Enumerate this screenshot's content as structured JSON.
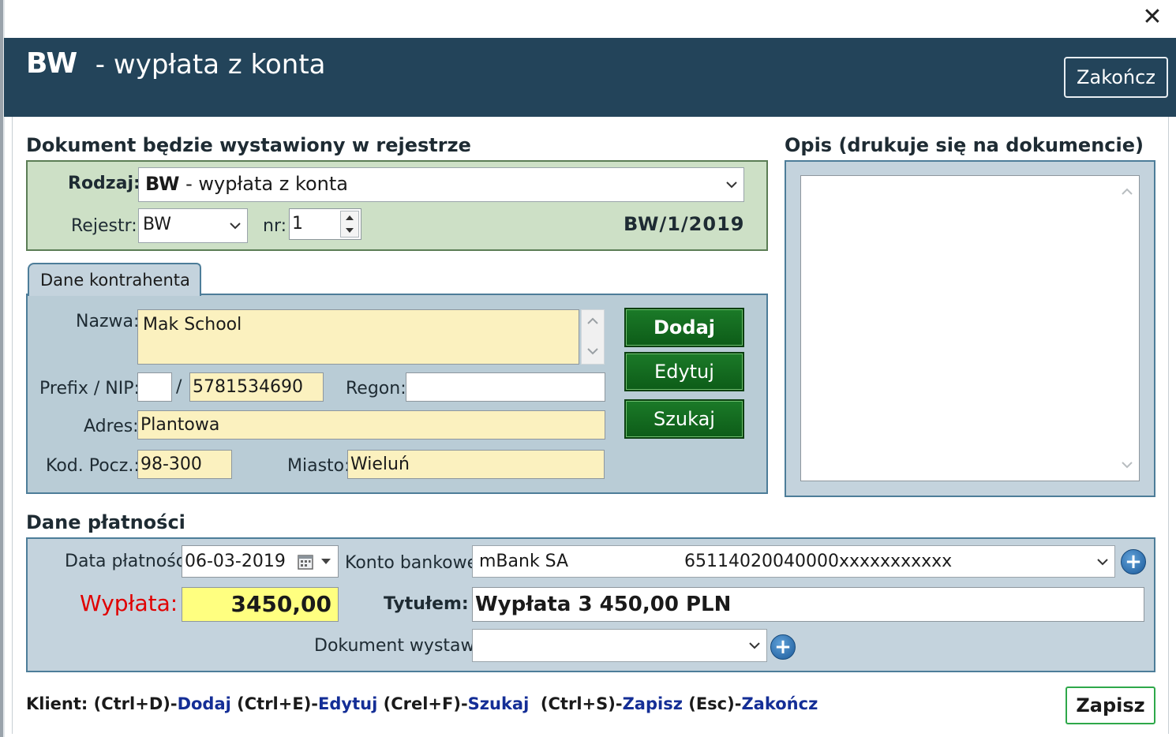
{
  "window": {
    "close_glyph": "✕"
  },
  "header": {
    "title_code": "BW",
    "title_rest": " - wypłata z konta",
    "close_button": "Zakończ"
  },
  "register_section": {
    "title": "Dokument będzie wystawiony w rejestrze",
    "rodzaj_label": "Rodzaj:",
    "rodzaj_code": "BW",
    "rodzaj_rest": " - wypłata z konta",
    "rejestr_label": "Rejestr:",
    "rejestr_value": "BW",
    "nr_label": "nr:",
    "nr_value": "1",
    "document_number": "BW/1/2019"
  },
  "contractor": {
    "tab_label": "Dane kontrahenta",
    "nazwa_label": "Nazwa:",
    "nazwa_value": "Mak School",
    "prefix_nip_label": "Prefix / NIP:",
    "prefix_value": "",
    "slash": "/",
    "nip_value": "5781534690",
    "regon_label": "Regon:",
    "regon_value": "",
    "adres_label": "Adres:",
    "adres_value": "Plantowa",
    "kod_label": "Kod. Pocz.:",
    "kod_value": "98-300",
    "miasto_label": "Miasto:",
    "miasto_value": "Wieluń",
    "buttons": {
      "dodaj": "Dodaj",
      "edytuj": "Edytuj",
      "szukaj": "Szukaj"
    }
  },
  "description": {
    "title": "Opis (drukuje się na dokumencie)",
    "value": ""
  },
  "payment": {
    "title": "Dane płatności",
    "data_label": "Data płatności:",
    "data_value": "06-03-2019",
    "konto_label": "Konto bankowe:",
    "bank_name": "mBank SA",
    "account_number": "65114020040000xxxxxxxxxxx",
    "wyplata_label": "Wypłata:",
    "wyplata_value": "3450,00",
    "tytulem_label": "Tytułem:",
    "tytulem_value": "Wypłata 3 450,00 PLN",
    "wystawil_label": "Dokument wystawił:",
    "wystawil_value": ""
  },
  "shortcuts": {
    "prefix": "Klient: ",
    "k1": "(Ctrl+D)-",
    "a1": "Dodaj",
    "k2": " (Ctrl+E)-",
    "a2": "Edytuj",
    "k3": " (Crel+F)-",
    "a3": "Szukaj",
    "k4": "  (Ctrl+S)-",
    "a4": "Zapisz",
    "k5": " (Esc)-",
    "a5": "Zakończ"
  },
  "save_button": "Zapisz",
  "colors": {
    "header_bg": "#23445a",
    "green_panel": "#cde0c6",
    "blue_panel": "#c4d3dd",
    "field_yellow": "#fbf1bf",
    "amount_yellow": "#ffff80",
    "wyplata_red": "#e00000",
    "link_blue": "#142e96",
    "button_green": "#0d5c18"
  }
}
